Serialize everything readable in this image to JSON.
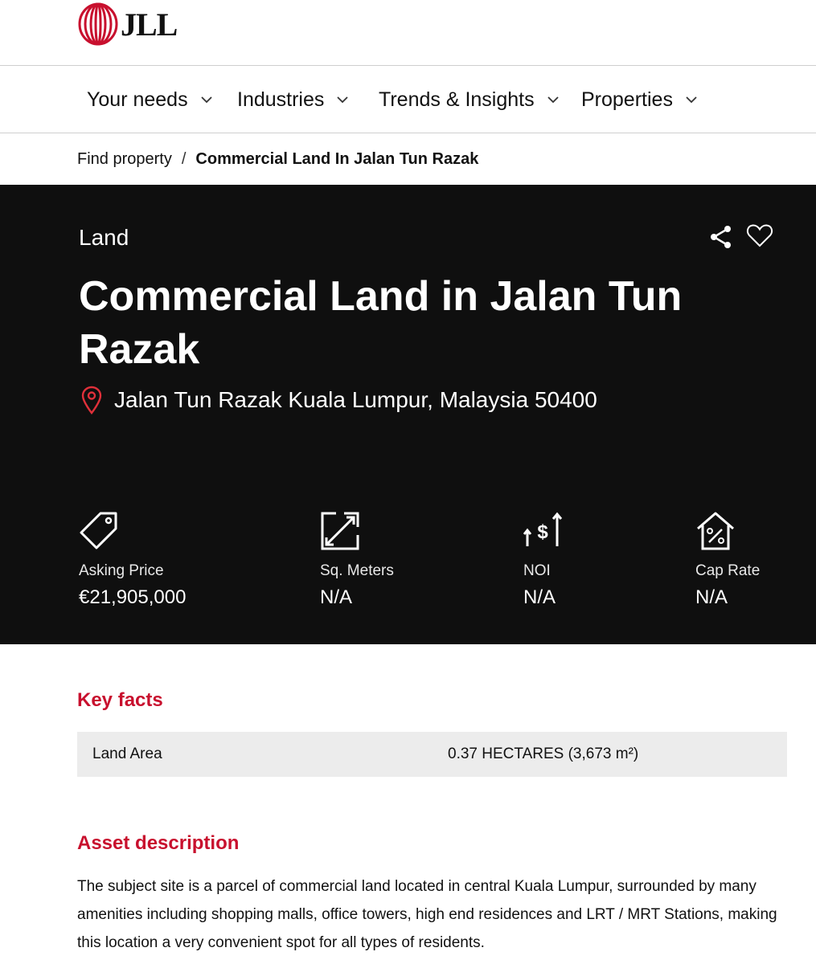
{
  "brand": {
    "name": "JLL",
    "accent": "#c8102e"
  },
  "nav": {
    "items": [
      {
        "label": "Your needs"
      },
      {
        "label": "Industries"
      },
      {
        "label": "Trends & Insights"
      },
      {
        "label": "Properties"
      }
    ]
  },
  "breadcrumb": {
    "parent": "Find property",
    "separator": "/",
    "current": "Commercial Land In Jalan Tun Razak"
  },
  "hero": {
    "type": "Land",
    "title": "Commercial Land in Jalan Tun Razak",
    "address": "Jalan Tun Razak Kuala Lumpur, Malaysia 50400",
    "icons": {
      "share": "share-icon",
      "favorite": "heart-icon",
      "location": "map-pin-icon"
    }
  },
  "stats": [
    {
      "label": "Asking Price",
      "value": "€21,905,000",
      "icon": "price-tag-icon"
    },
    {
      "label": "Sq. Meters",
      "value": "N/A",
      "icon": "resize-arrows-icon"
    },
    {
      "label": "NOI",
      "value": "N/A",
      "icon": "dollar-up-icon"
    },
    {
      "label": "Cap Rate",
      "value": "N/A",
      "icon": "house-percent-icon"
    }
  ],
  "key_facts": {
    "title": "Key facts",
    "rows": [
      {
        "key": "Land Area",
        "value": "0.37 HECTARES (3,673 m²)"
      }
    ]
  },
  "asset_description": {
    "title": "Asset description",
    "text": "The subject site is a parcel of commercial land located in central Kuala Lumpur, surrounded by many amenities including shopping malls, office towers, high end residences and LRT / MRT Stations, making this location a very convenient spot for all types of residents."
  }
}
